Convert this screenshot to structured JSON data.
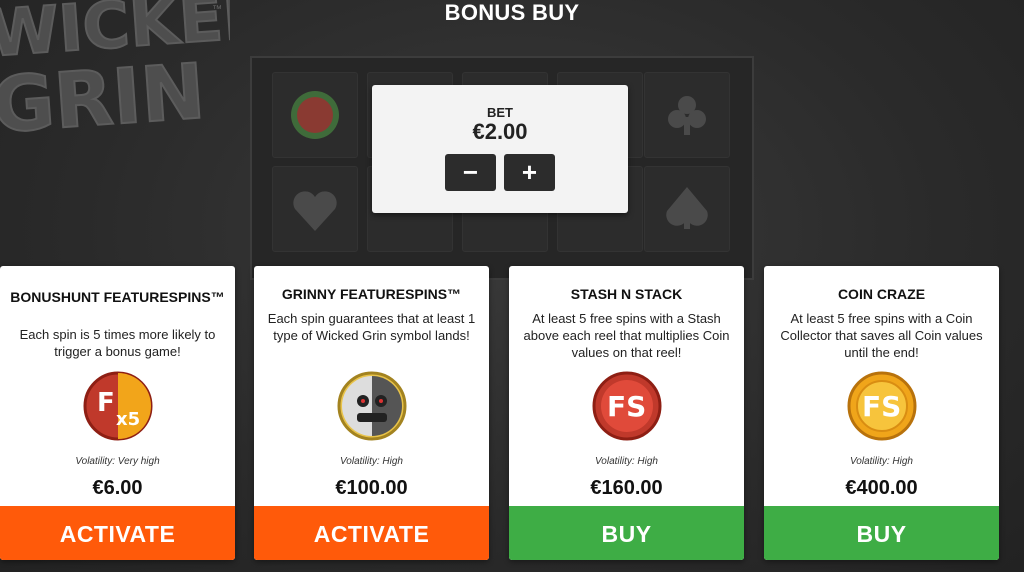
{
  "header": {
    "title": "BONUS BUY"
  },
  "logo": {
    "text_line1": "WICKED",
    "text_line2": "GRIN",
    "trademark": "™"
  },
  "bet": {
    "label": "BET",
    "value": "€2.00",
    "minus_label": "−",
    "plus_label": "+"
  },
  "colors": {
    "activate": "#ff5a0a",
    "buy": "#3ead45",
    "card_bg": "#ffffff",
    "background": "#2b2b2b"
  },
  "cards": [
    {
      "title": "BONUSHUNT FEATURESPINS™",
      "description": "Each spin is 5 times more likely to trigger a bonus game!",
      "icon": "fs-x5-badge-icon",
      "volatility": "Volatility: Very high",
      "price": "€6.00",
      "action": "ACTIVATE"
    },
    {
      "title": "GRINNY FEATURESPINS™",
      "description": "Each spin guarantees that at least 1 type of Wicked Grin symbol lands!",
      "icon": "grinny-face-badge-icon",
      "volatility": "Volatility: High",
      "price": "€100.00",
      "action": "ACTIVATE"
    },
    {
      "title": "STASH N STACK",
      "description": "At least 5 free spins with a Stash above each reel that multiplies Coin values on that reel!",
      "icon": "fs-red-badge-icon",
      "volatility": "Volatility: High",
      "price": "€160.00",
      "action": "BUY"
    },
    {
      "title": "COIN CRAZE",
      "description": "At least 5 free spins with a Coin Collector that saves all Coin values until the end!",
      "icon": "fs-gold-coin-badge-icon",
      "volatility": "Volatility: High",
      "price": "€400.00",
      "action": "BUY"
    }
  ]
}
